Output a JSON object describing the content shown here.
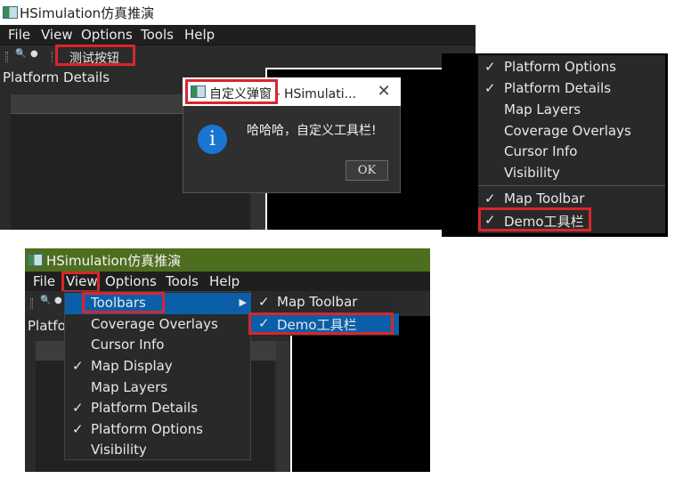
{
  "top_window": {
    "title": "HSimulation仿真推演",
    "menu": [
      "File",
      "View",
      "Options",
      "Tools",
      "Help"
    ],
    "toolbar_button": "测试按钮",
    "panel_title": "Platform Details"
  },
  "dialog": {
    "title": "自定义弹窗 - HSimulati...",
    "close": "✕",
    "icon": "i",
    "message": "哈哈哈，自定义工具栏!",
    "ok_label": "OK"
  },
  "popup_menu": {
    "items": [
      {
        "check": "✓",
        "label": "Platform Options"
      },
      {
        "check": "✓",
        "label": "Platform Details"
      },
      {
        "check": "",
        "label": "Map Layers"
      },
      {
        "check": "",
        "label": "Coverage Overlays"
      },
      {
        "check": "",
        "label": "Cursor Info"
      },
      {
        "check": "",
        "label": "Visibility"
      },
      {
        "check": "✓",
        "label": "Map Toolbar"
      },
      {
        "check": "✓",
        "label": "Demo工具栏"
      }
    ]
  },
  "bottom_window": {
    "title": "HSimulation仿真推演",
    "menu": [
      "File",
      "View",
      "Options",
      "Tools",
      "Help"
    ],
    "panel_title": "Platfo"
  },
  "view_menu": {
    "items": [
      {
        "check": "",
        "label": "Toolbars",
        "arrow": "▶"
      },
      {
        "check": "",
        "label": "Coverage Overlays"
      },
      {
        "check": "",
        "label": "Cursor Info"
      },
      {
        "check": "✓",
        "label": "Map Display"
      },
      {
        "check": "",
        "label": "Map Layers"
      },
      {
        "check": "✓",
        "label": "Platform Details"
      },
      {
        "check": "✓",
        "label": "Platform Options"
      },
      {
        "check": "",
        "label": "Visibility"
      }
    ]
  },
  "toolbars_submenu": {
    "items": [
      {
        "check": "✓",
        "label": "Map Toolbar"
      },
      {
        "check": "✓",
        "label": "Demo工具栏"
      }
    ]
  },
  "colors": {
    "highlight": "#0b5fa8",
    "annotation": "#d8262c",
    "title_green": "#4e6e1f"
  }
}
